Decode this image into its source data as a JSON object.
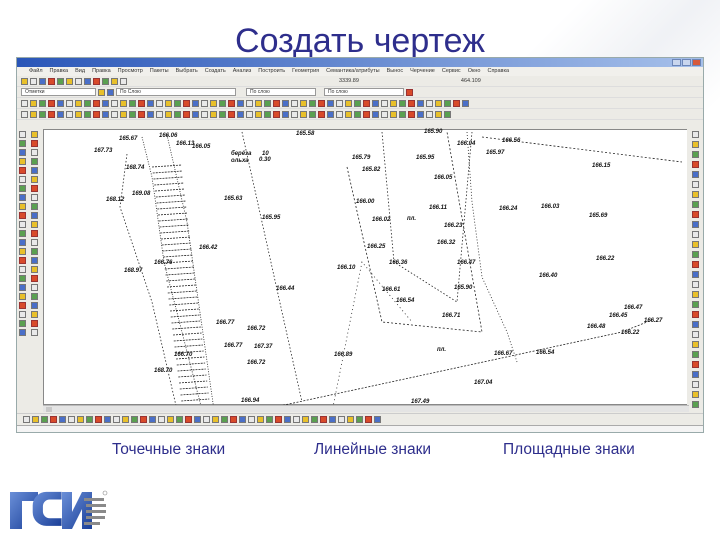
{
  "slide": {
    "title": "Создать чертеж",
    "captions": [
      "Точечные знаки",
      "Линейные знаки",
      "Площадные знаки"
    ],
    "logo_text": "ГСИ"
  },
  "window": {
    "title": "",
    "menu": [
      "Файл",
      "Правка",
      "Вид",
      "Правка",
      "Просмотр",
      "Пакеты",
      "Выбрать",
      "Создать",
      "Анализ",
      "Построить",
      "Геометрия",
      "Семантика/атрибуты",
      "Вынос",
      "Черчение",
      "Сервис",
      "Окно",
      "Справка"
    ],
    "coord_x": "3339.89",
    "coord_y": "464.109",
    "layer_select": "Отметки",
    "color_select": "По Слою",
    "linetype_select": "По слою",
    "lineweight_select": "По слою"
  },
  "drawing": {
    "labels": [
      "165.67",
      "166.06",
      "166.13",
      "166.05",
      "165.58",
      "167.73",
      "168.74",
      "берёза",
      "ольха",
      "10",
      "0.30",
      "169.08",
      "168.12",
      "165.63",
      "165.95",
      "166.42",
      "166.76",
      "165.79",
      "165.82",
      "166.00",
      "166.02",
      "166.25",
      "165.90",
      "166.04",
      "166.56",
      "165.97",
      "165.95",
      "166.05",
      "166.15",
      "166.11",
      "пл.",
      "166.24",
      "166.03",
      "165.69",
      "166.23",
      "166.32",
      "166.47",
      "166.22",
      "166.36",
      "166.10",
      "168.97",
      "166.44",
      "166.77",
      "166.72",
      "166.77",
      "167.37",
      "166.70",
      "166.72",
      "166.89",
      "168.70",
      "166.94",
      "166.40",
      "165.90",
      "166.61",
      "166.54",
      "166.71",
      "166.47",
      "166.45",
      "166.27",
      "166.48",
      "166.22",
      "пл.",
      "166.67",
      "166.54",
      "167.04",
      "167.49"
    ]
  },
  "colors": {
    "title": "#2e2e8c",
    "titlebar": "#2a56b8",
    "logo": "#1f4fa8",
    "status_line": "#5bc6d6"
  }
}
